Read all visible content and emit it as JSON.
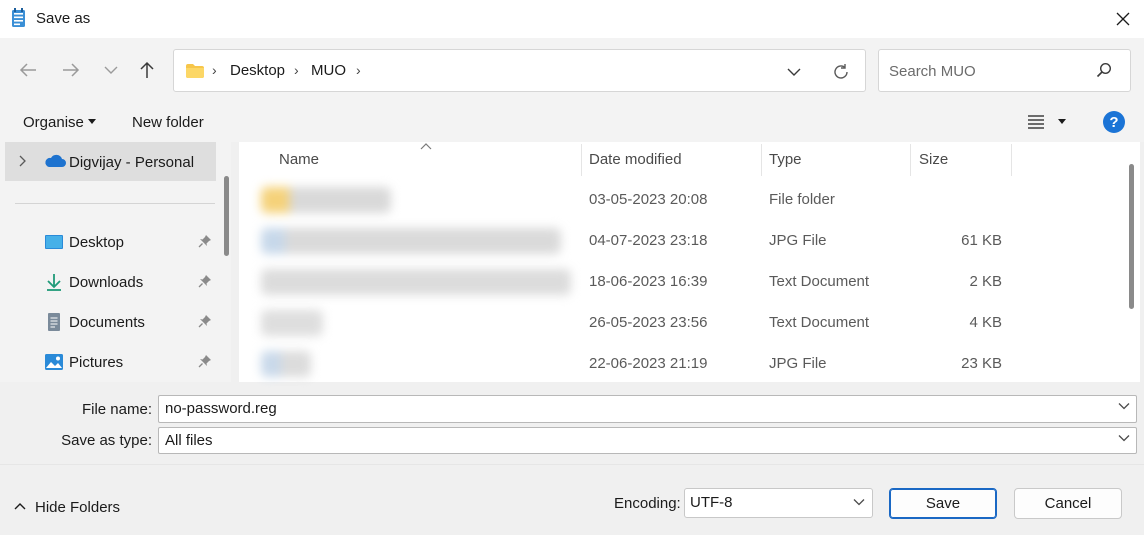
{
  "window": {
    "title": "Save as",
    "close_glyph": "✕"
  },
  "nav": {
    "back_icon": "arrow-left-icon",
    "forward_icon": "arrow-right-icon",
    "recent_icon": "chevron-down-icon",
    "up_icon": "arrow-up-icon",
    "breadcrumb": [
      "Desktop",
      "MUO"
    ],
    "separator": "›"
  },
  "search": {
    "placeholder": "Search MUO"
  },
  "toolbar": {
    "organise_label": "Organise",
    "new_folder_label": "New folder",
    "help_glyph": "?"
  },
  "sidebar": {
    "account": "Digvijay - Personal",
    "items": [
      {
        "label": "Desktop",
        "icon": "desktop-icon"
      },
      {
        "label": "Downloads",
        "icon": "download-icon"
      },
      {
        "label": "Documents",
        "icon": "document-icon"
      },
      {
        "label": "Pictures",
        "icon": "pictures-icon"
      }
    ]
  },
  "files": {
    "columns": [
      "Name",
      "Date modified",
      "Type",
      "Size"
    ],
    "rows": [
      {
        "date": "03-05-2023 20:08",
        "type": "File folder",
        "size": ""
      },
      {
        "date": "04-07-2023 23:18",
        "type": "JPG File",
        "size": "61 KB"
      },
      {
        "date": "18-06-2023 16:39",
        "type": "Text Document",
        "size": "2 KB"
      },
      {
        "date": "26-05-2023 23:56",
        "type": "Text Document",
        "size": "4 KB"
      },
      {
        "date": "22-06-2023 21:19",
        "type": "JPG File",
        "size": "23 KB"
      }
    ]
  },
  "form": {
    "file_name_label": "File name:",
    "file_name_value": "no-password.reg",
    "save_type_label": "Save as type:",
    "save_type_value": "All files"
  },
  "footer": {
    "hide_folders_label": "Hide Folders",
    "encoding_label": "Encoding:",
    "encoding_value": "UTF-8",
    "save_label": "Save",
    "cancel_label": "Cancel"
  }
}
